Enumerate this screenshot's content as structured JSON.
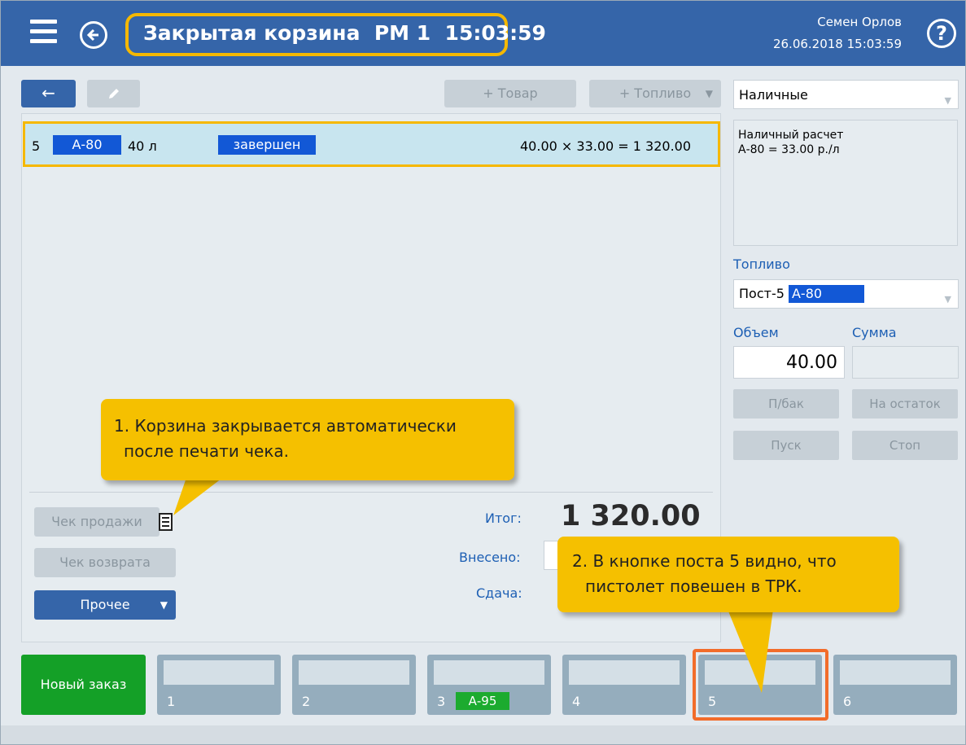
{
  "header": {
    "title": "Закрытая корзина  РМ 1  15:03:59",
    "user_name": "Семен Орлов",
    "datetime": "26.06.2018 15:03:59",
    "help_label": "?"
  },
  "toolbar": {
    "back_label": "←",
    "add_goods_label": "+ Товар",
    "add_fuel_label": "+ Топливо",
    "dropdown_arrow": "▼"
  },
  "order": {
    "items": [
      {
        "post": "5",
        "fuel": "А-80",
        "quantity": "40 л",
        "status": "завершен",
        "calculation": "40.00 × 33.00 = 1 320.00"
      }
    ]
  },
  "actions": {
    "sale_receipt_label": "Чек продажи",
    "return_receipt_label": "Чек возврата",
    "other_label": "Прочее",
    "other_arrow": "▼"
  },
  "totals": {
    "total_label": "Итог:",
    "total_value": "1 320.00",
    "paid_label": "Внесено:",
    "change_label": "Сдача:"
  },
  "payment": {
    "method": "Наличные",
    "info_line1": "Наличный расчет",
    "info_line2": "А-80 = 33.00 р./л",
    "arrow": "▼"
  },
  "fuel_panel": {
    "fuel_label": "Топливо",
    "post_label": "Пост-5",
    "fuel_value": "А-80",
    "volume_label": "Объем",
    "sum_label": "Сумма",
    "volume_value": "40.00",
    "btn_full_tank": "П/бак",
    "btn_remainder": "На остаток",
    "btn_start": "Пуск",
    "btn_stop": "Стоп"
  },
  "posts_bar": {
    "new_order_label": "Новый заказ",
    "posts": [
      {
        "number": "1",
        "fuel": ""
      },
      {
        "number": "2",
        "fuel": ""
      },
      {
        "number": "3",
        "fuel": "А-95"
      },
      {
        "number": "4",
        "fuel": ""
      },
      {
        "number": "5",
        "fuel": ""
      },
      {
        "number": "6",
        "fuel": ""
      }
    ]
  },
  "callouts": {
    "callout1_line1": "1. Корзина закрывается автоматически",
    "callout1_line2": "после печати чека.",
    "callout2_line1": "2. В кнопке поста 5 видно, что",
    "callout2_line2": "пистолет повешен в ТРК."
  },
  "colors": {
    "header_bg": "#3565a9",
    "highlight_yellow": "#f5b800",
    "fuel_blue": "#1258d6",
    "new_order_green": "#14a027",
    "post_fuel_green": "#1cab2f",
    "post_highlight_orange": "#f26c2a",
    "callout_yellow": "#f5c000"
  }
}
